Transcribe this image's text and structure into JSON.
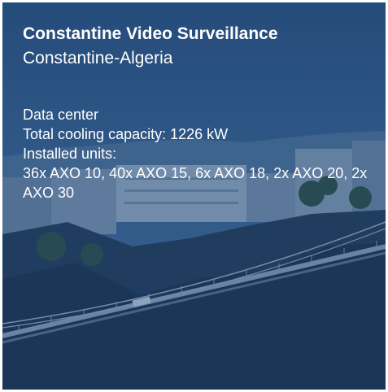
{
  "card": {
    "title": "Constantine Video Surveillance",
    "location": "Constantine-Algeria",
    "type": "Data center",
    "cooling_capacity": "Total cooling capacity:  1226 kW",
    "installed_label": "Installed units:",
    "installed_units": "36x AXO 10, 40x AXO 15, 6x AXO 18, 2x AXO 20, 2x AXO 30"
  },
  "colors": {
    "overlay": "#1e4678",
    "text": "#ffffff"
  }
}
